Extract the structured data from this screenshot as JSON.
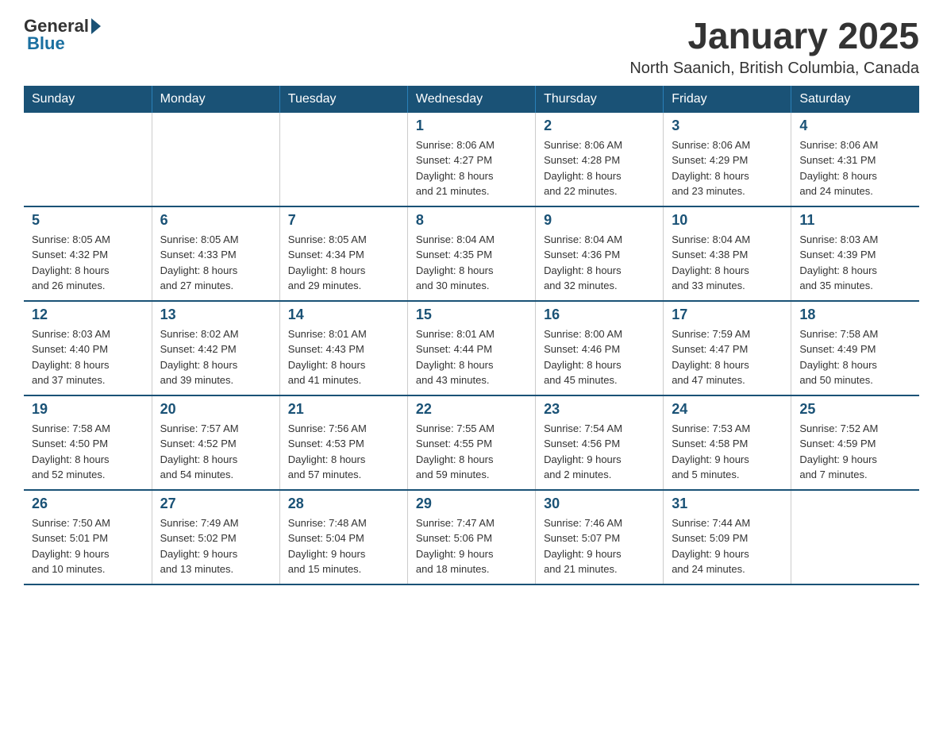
{
  "header": {
    "logo_general": "General",
    "logo_blue": "Blue",
    "month_year": "January 2025",
    "location": "North Saanich, British Columbia, Canada"
  },
  "days_of_week": [
    "Sunday",
    "Monday",
    "Tuesday",
    "Wednesday",
    "Thursday",
    "Friday",
    "Saturday"
  ],
  "weeks": [
    [
      {
        "day": "",
        "info": ""
      },
      {
        "day": "",
        "info": ""
      },
      {
        "day": "",
        "info": ""
      },
      {
        "day": "1",
        "info": "Sunrise: 8:06 AM\nSunset: 4:27 PM\nDaylight: 8 hours\nand 21 minutes."
      },
      {
        "day": "2",
        "info": "Sunrise: 8:06 AM\nSunset: 4:28 PM\nDaylight: 8 hours\nand 22 minutes."
      },
      {
        "day": "3",
        "info": "Sunrise: 8:06 AM\nSunset: 4:29 PM\nDaylight: 8 hours\nand 23 minutes."
      },
      {
        "day": "4",
        "info": "Sunrise: 8:06 AM\nSunset: 4:31 PM\nDaylight: 8 hours\nand 24 minutes."
      }
    ],
    [
      {
        "day": "5",
        "info": "Sunrise: 8:05 AM\nSunset: 4:32 PM\nDaylight: 8 hours\nand 26 minutes."
      },
      {
        "day": "6",
        "info": "Sunrise: 8:05 AM\nSunset: 4:33 PM\nDaylight: 8 hours\nand 27 minutes."
      },
      {
        "day": "7",
        "info": "Sunrise: 8:05 AM\nSunset: 4:34 PM\nDaylight: 8 hours\nand 29 minutes."
      },
      {
        "day": "8",
        "info": "Sunrise: 8:04 AM\nSunset: 4:35 PM\nDaylight: 8 hours\nand 30 minutes."
      },
      {
        "day": "9",
        "info": "Sunrise: 8:04 AM\nSunset: 4:36 PM\nDaylight: 8 hours\nand 32 minutes."
      },
      {
        "day": "10",
        "info": "Sunrise: 8:04 AM\nSunset: 4:38 PM\nDaylight: 8 hours\nand 33 minutes."
      },
      {
        "day": "11",
        "info": "Sunrise: 8:03 AM\nSunset: 4:39 PM\nDaylight: 8 hours\nand 35 minutes."
      }
    ],
    [
      {
        "day": "12",
        "info": "Sunrise: 8:03 AM\nSunset: 4:40 PM\nDaylight: 8 hours\nand 37 minutes."
      },
      {
        "day": "13",
        "info": "Sunrise: 8:02 AM\nSunset: 4:42 PM\nDaylight: 8 hours\nand 39 minutes."
      },
      {
        "day": "14",
        "info": "Sunrise: 8:01 AM\nSunset: 4:43 PM\nDaylight: 8 hours\nand 41 minutes."
      },
      {
        "day": "15",
        "info": "Sunrise: 8:01 AM\nSunset: 4:44 PM\nDaylight: 8 hours\nand 43 minutes."
      },
      {
        "day": "16",
        "info": "Sunrise: 8:00 AM\nSunset: 4:46 PM\nDaylight: 8 hours\nand 45 minutes."
      },
      {
        "day": "17",
        "info": "Sunrise: 7:59 AM\nSunset: 4:47 PM\nDaylight: 8 hours\nand 47 minutes."
      },
      {
        "day": "18",
        "info": "Sunrise: 7:58 AM\nSunset: 4:49 PM\nDaylight: 8 hours\nand 50 minutes."
      }
    ],
    [
      {
        "day": "19",
        "info": "Sunrise: 7:58 AM\nSunset: 4:50 PM\nDaylight: 8 hours\nand 52 minutes."
      },
      {
        "day": "20",
        "info": "Sunrise: 7:57 AM\nSunset: 4:52 PM\nDaylight: 8 hours\nand 54 minutes."
      },
      {
        "day": "21",
        "info": "Sunrise: 7:56 AM\nSunset: 4:53 PM\nDaylight: 8 hours\nand 57 minutes."
      },
      {
        "day": "22",
        "info": "Sunrise: 7:55 AM\nSunset: 4:55 PM\nDaylight: 8 hours\nand 59 minutes."
      },
      {
        "day": "23",
        "info": "Sunrise: 7:54 AM\nSunset: 4:56 PM\nDaylight: 9 hours\nand 2 minutes."
      },
      {
        "day": "24",
        "info": "Sunrise: 7:53 AM\nSunset: 4:58 PM\nDaylight: 9 hours\nand 5 minutes."
      },
      {
        "day": "25",
        "info": "Sunrise: 7:52 AM\nSunset: 4:59 PM\nDaylight: 9 hours\nand 7 minutes."
      }
    ],
    [
      {
        "day": "26",
        "info": "Sunrise: 7:50 AM\nSunset: 5:01 PM\nDaylight: 9 hours\nand 10 minutes."
      },
      {
        "day": "27",
        "info": "Sunrise: 7:49 AM\nSunset: 5:02 PM\nDaylight: 9 hours\nand 13 minutes."
      },
      {
        "day": "28",
        "info": "Sunrise: 7:48 AM\nSunset: 5:04 PM\nDaylight: 9 hours\nand 15 minutes."
      },
      {
        "day": "29",
        "info": "Sunrise: 7:47 AM\nSunset: 5:06 PM\nDaylight: 9 hours\nand 18 minutes."
      },
      {
        "day": "30",
        "info": "Sunrise: 7:46 AM\nSunset: 5:07 PM\nDaylight: 9 hours\nand 21 minutes."
      },
      {
        "day": "31",
        "info": "Sunrise: 7:44 AM\nSunset: 5:09 PM\nDaylight: 9 hours\nand 24 minutes."
      },
      {
        "day": "",
        "info": ""
      }
    ]
  ]
}
